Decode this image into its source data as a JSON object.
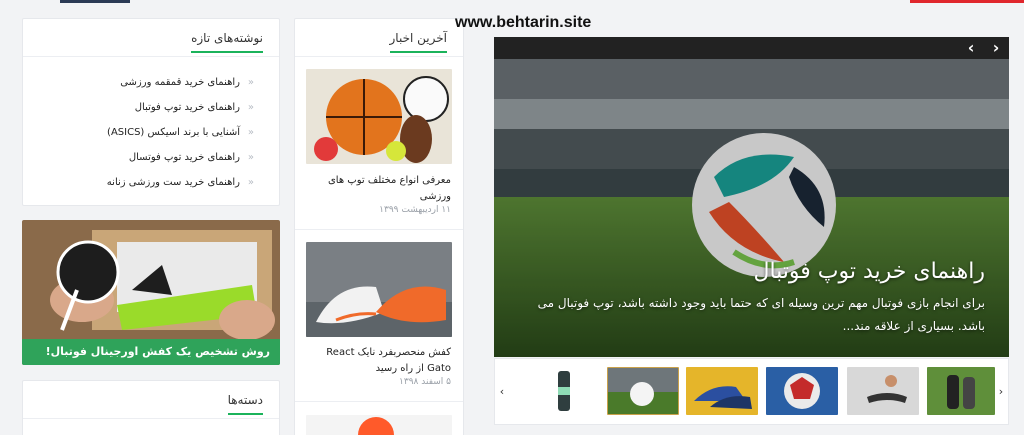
{
  "watermark": "www.behtarin.site",
  "colors": {
    "accent": "#1bb35b",
    "promo_band": "#2fa35a",
    "brand_red": "#e0262c"
  },
  "recent_posts": {
    "title": "نوشته‌های تازه",
    "items": [
      {
        "label": "راهنمای خرید قمقمه ورزشی"
      },
      {
        "label": "راهنمای خرید توپ فوتبال"
      },
      {
        "label": "آشنایی با برند اسیکس (ASICS)"
      },
      {
        "label": "راهنمای خرید توپ فوتسال"
      },
      {
        "label": "راهنمای خرید ست ورزشی زنانه"
      }
    ]
  },
  "promo": {
    "caption": "روش تشخیص یک کفش اورجینال فوتبال!"
  },
  "categories": {
    "title": "دسته‌ها"
  },
  "latest_news": {
    "title": "آخرین اخبار",
    "items": [
      {
        "title": "معرفی انواع مختلف توپ های ورزشی",
        "date": "۱۱ اردیبهشت ۱۳۹۹"
      },
      {
        "title": "کفش منحصربفرد نایک React Gato از راه رسید",
        "date": "۵ اسفند ۱۳۹۸"
      }
    ]
  },
  "slider": {
    "title": "راهنمای خرید توپ فوتبال",
    "excerpt": "برای انجام بازی فوتبال مهم ترین وسیله ای که حتما باید وجود داشته باشد، توپ فوتبال می باشد. بسیاری از علاقه مند...",
    "prev_icon": "chevron-left-icon",
    "next_icon": "chevron-right-icon"
  }
}
